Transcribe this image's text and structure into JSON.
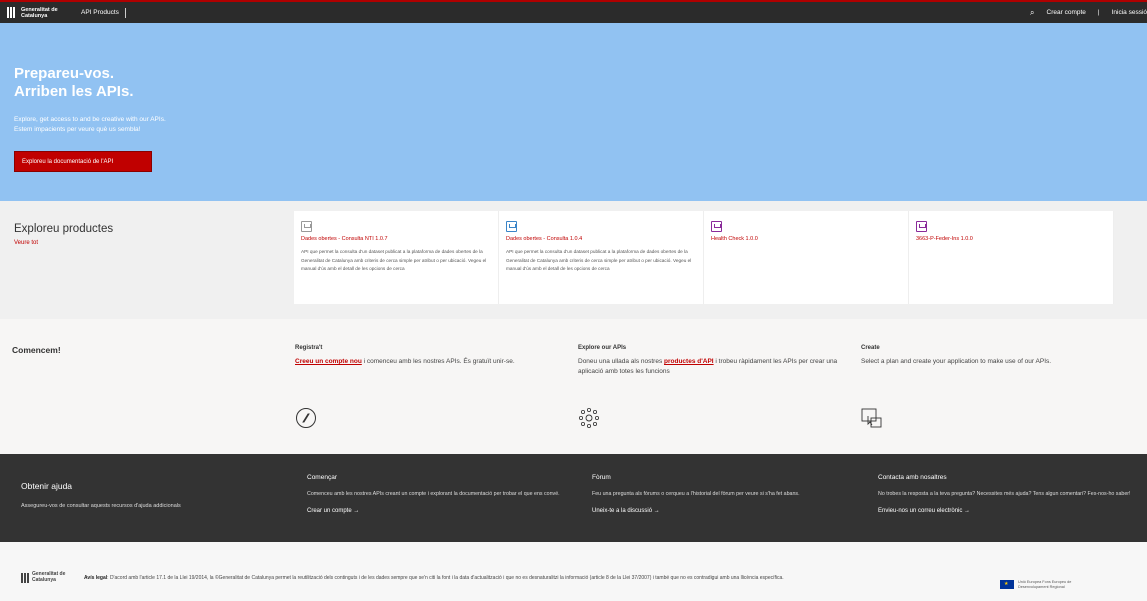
{
  "topbar": {
    "logo_text": "Generalitat de Catalunya",
    "product_label": "API Products",
    "search_icon": "search-icon",
    "register_label": "Crear compte",
    "separator": "|",
    "login_label": "Inicia sessió"
  },
  "hero": {
    "title_line1": "Prepareu-vos.",
    "title_line2": "Arriben les APIs.",
    "subtitle_line1": "Explore, get access to and be creative with our APIs.",
    "subtitle_line2": "Estem impacients per veure què us sembla!",
    "button_label": "Exploreu la documentació de l'API"
  },
  "products": {
    "title": "Exploreu productes",
    "see_all": "Veure tot",
    "cards": [
      {
        "icon": "gray",
        "title": "Dades obertes - Consulta NTI 1.0.7",
        "desc": "API que permet la consulta d'un dataset publicat a la plataforma de dades obertes de la Generalitat de Catalunya amb criteris de cerca simple per atribut o per ubicació. Vegeu el manual d'ús amb el detall de les opcions de cerca"
      },
      {
        "icon": "blue",
        "title": "Dades obertes - Consulta 1.0.4",
        "desc": "API que permet la consulta d'un dataset publicat a la plataforma de dades obertes de la Generalitat de Catalunya amb criteris de cerca simple per atribut o per ubicació. Vegeu el manual d'ús amb el detall de les opcions de cerca"
      },
      {
        "icon": "purple",
        "title": "Health Check 1.0.0",
        "desc": ""
      },
      {
        "icon": "purple",
        "title": "3663-P-Feder-Ins 1.0.0",
        "desc": ""
      }
    ]
  },
  "start": {
    "title": "Comencem!",
    "register": {
      "heading": "Registra't",
      "link": "Creeu un compte nou",
      "text": " i comenceu amb les nostres APIs. És gratuït unir-se."
    },
    "explore": {
      "heading": "Explore our APIs",
      "text_before": "Doneu una ullada als nostres ",
      "link": "productes d'API",
      "text_after": " i trobeu ràpidament les APIs per crear una aplicació amb totes les funcions"
    },
    "create": {
      "heading": "Create",
      "text": "Select a plan and create your application to make use of our APIs."
    }
  },
  "help": {
    "title": "Obtenir ajuda",
    "subtitle": "Assegureu-vos de consultar aquests recursos d'ajuda addicionals",
    "columns": [
      {
        "heading": "Començar",
        "text": "Comenceu amb les nostres APIs creant un compte i explorant la documentació per trobar el que ens convé.",
        "link": "Crear un compte →"
      },
      {
        "heading": "Fòrum",
        "text": "Feu una pregunta als fòrums o cerqueu a l'historial del fòrum per veure si s'ha fet abans.",
        "link": "Uneix-te a la discussió →"
      },
      {
        "heading": "Contacta amb nosaltres",
        "text": "No trobes la resposta a la teva pregunta? Necessites més ajuda? Tens algun comentari? Fes-nos-ho saber!",
        "link": "Envieu-nos un correu electrònic →"
      }
    ]
  },
  "footer": {
    "logo_text": "Generalitat de Catalunya",
    "legal_label": "Avís legal",
    "legal_text": ": D'acord amb l'article 17.1 de la Llei 19/2014, la ©Generalitat de Catalunya permet la reutilització dels continguts i de les dades sempre que se'n citi la font i la data d'actualització i que no es desnaturalitzi la informació (article 8 de la Llei 37/2007) i també que no es contradigui amb una llicència específica.",
    "eu_text": "Unió Europea Fons Europeu de Desenvolupament Regional"
  },
  "colors": {
    "accent": "#c00000",
    "hero_bg": "#91c2f2",
    "dark_bg": "#333333"
  }
}
